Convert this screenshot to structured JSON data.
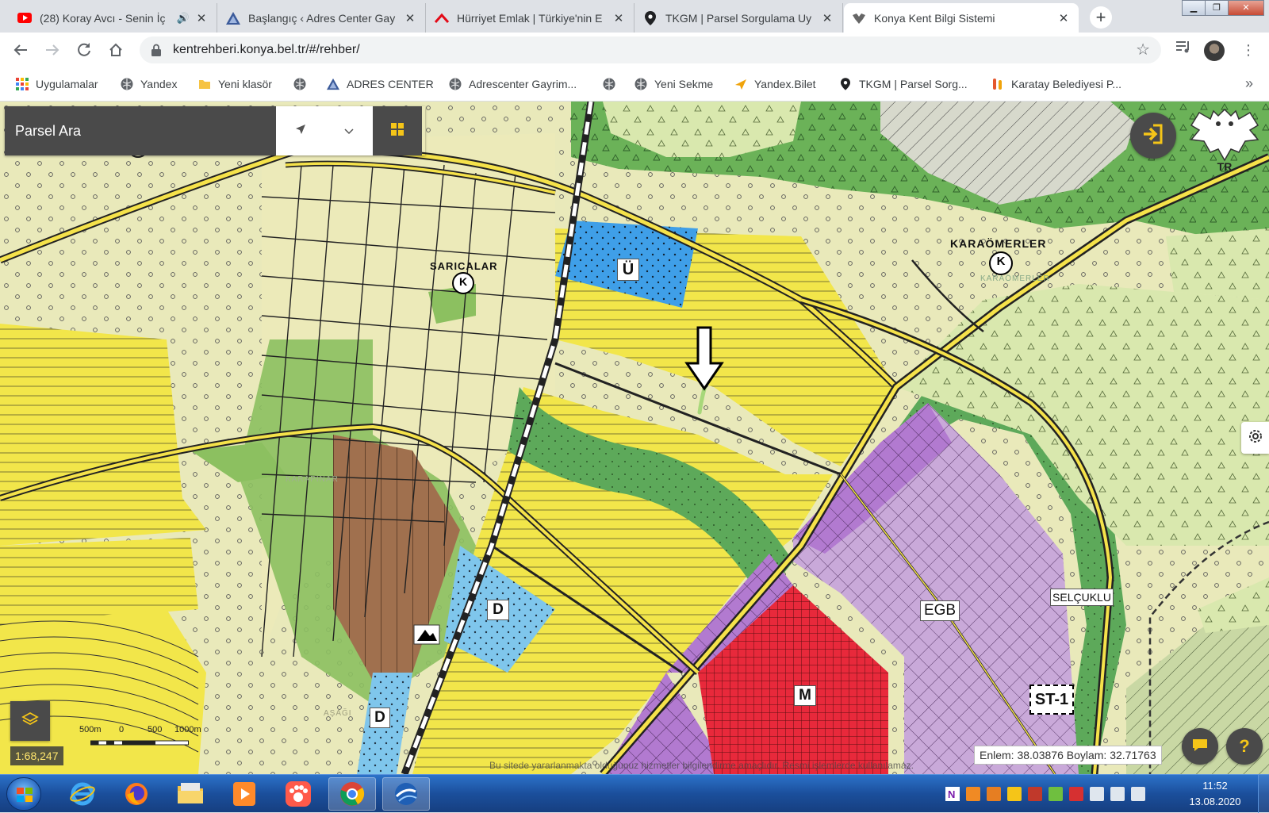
{
  "browser": {
    "tabs": [
      {
        "title": "(28) Koray Avcı - Senin İç",
        "favicon": "youtube-icon",
        "active": false
      },
      {
        "title": "Başlangıç ‹ Adres Center Gay",
        "favicon": "adres-center-icon",
        "active": false
      },
      {
        "title": "Hürriyet Emlak | Türkiye'nin E",
        "favicon": "hurriyet-emlak-icon",
        "active": false
      },
      {
        "title": "TKGM | Parsel Sorgulama Uy",
        "favicon": "map-pin-icon",
        "active": false
      },
      {
        "title": "Konya Kent Bilgi Sistemi",
        "favicon": "konya-emblem-icon",
        "active": true
      }
    ],
    "close_glyph": "✕",
    "new_tab_glyph": "+",
    "url": "kentrehberi.konya.bel.tr/#/rehber/",
    "bookmarks": [
      {
        "label": "Uygulamalar",
        "icon": "apps-grid-icon"
      },
      {
        "label": "Yandex",
        "icon": "globe-icon"
      },
      {
        "label": "Yeni klasör",
        "icon": "folder-icon"
      },
      {
        "label": "",
        "icon": "globe-icon"
      },
      {
        "label": "ADRES CENTER",
        "icon": "adres-center-icon"
      },
      {
        "label": "Adrescenter Gayrim...",
        "icon": "globe-icon"
      },
      {
        "label": "",
        "icon": "globe-icon"
      },
      {
        "label": "Yeni Sekme",
        "icon": "globe-icon"
      },
      {
        "label": "Yandex.Bilet",
        "icon": "plane-icon"
      },
      {
        "label": "TKGM | Parsel Sorg...",
        "icon": "map-pin-icon"
      },
      {
        "label": "Karatay Belediyesi P...",
        "icon": "karatay-icon"
      }
    ],
    "bookmarks_more_glyph": "»"
  },
  "map": {
    "search_placeholder": "Parsel Ara",
    "emblem_text": "TR",
    "scale_ratio": "1:68,247",
    "scale_labels": [
      "500m",
      "0",
      "500",
      "1000m"
    ],
    "coordinates": "Enlem: 38.03876 Boylam: 32.71763",
    "disclaimer": "Bu sitede yararlanmakta olduğunuz hizmetler bilgilendirme amaçlıdır. Resmi işlemlerde kullanılamaz.",
    "help_glyph": "?",
    "labels": {
      "saricalar": "SARICALAR",
      "karaomerler": "KARAÖMERLER",
      "karaomerler_small": "KARAÖMERLER",
      "k_symbol": "K",
      "selcuklu": "SELÇUKLU",
      "egb": "EGB",
      "m": "M",
      "d": "D",
      "u": "Ü",
      "st1": "ST-1",
      "karapinar": "KARAPINAR",
      "asagi": "AŞAĞI"
    },
    "colors": {
      "housing_yellow": "#f2e64a",
      "green_area": "#7cbc5a",
      "light_green": "#d5e6a8",
      "pale_beige": "#ece9bd",
      "industry_purple": "#c8a8d8",
      "commercial_red": "#e8293b",
      "education_blue": "#7fc6ec",
      "health_blue": "#3f9fe8",
      "brown": "#a0704e"
    }
  },
  "taskbar": {
    "time": "11:52",
    "date": "13.08.2020",
    "apps": [
      "internet-explorer-icon",
      "firefox-icon",
      "file-explorer-icon",
      "media-player-icon",
      "paw-app-icon",
      "chrome-icon",
      "google-earth-icon"
    ]
  }
}
